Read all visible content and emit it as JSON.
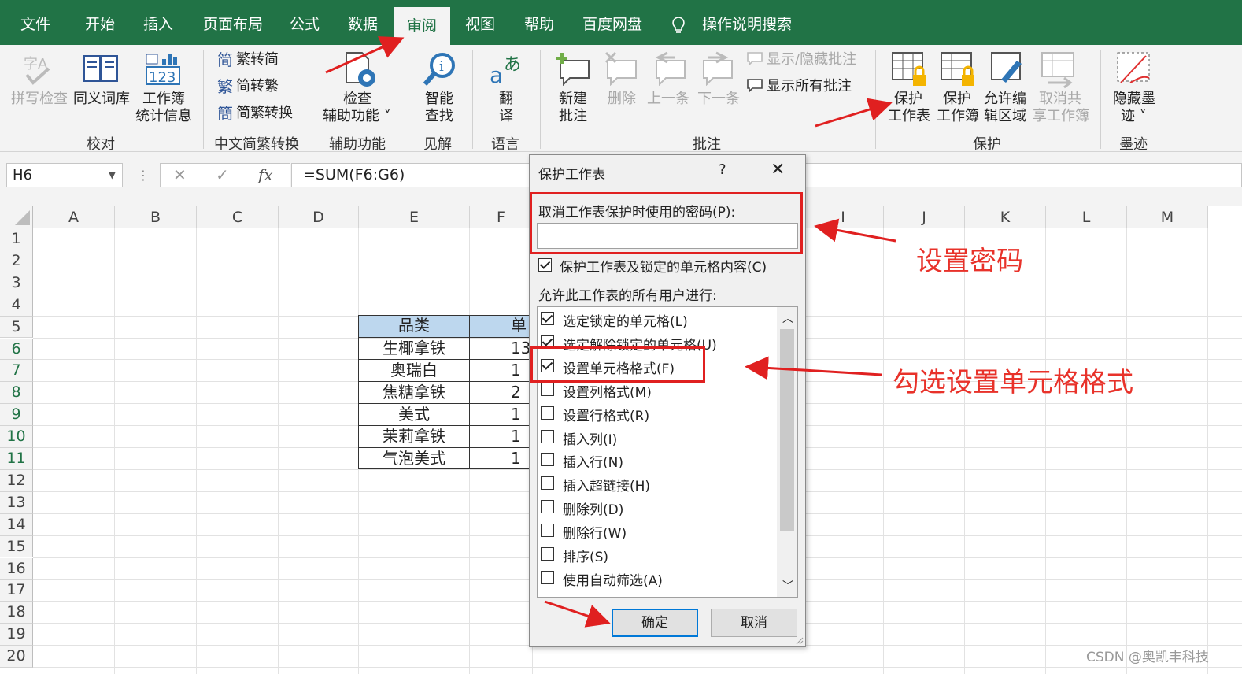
{
  "tabs": [
    "文件",
    "开始",
    "插入",
    "页面布局",
    "公式",
    "数据",
    "审阅",
    "视图",
    "帮助",
    "百度网盘",
    "操作说明搜索"
  ],
  "active_tab": "审阅",
  "ribbon": {
    "proofing": {
      "spell": "拼写检查",
      "thesaurus": "同义词库",
      "stats1": "工作簿",
      "stats2": "统计信息",
      "label": "校对"
    },
    "chinese": {
      "t2s": "繁转简",
      "s2t": "简转繁",
      "convert": "简繁转换",
      "label": "中文简繁转换"
    },
    "accessibility": {
      "check1": "检查",
      "check2": "辅助功能 ˅",
      "label": "辅助功能"
    },
    "insights": {
      "smart1": "智能",
      "smart2": "查找",
      "label": "见解"
    },
    "language": {
      "trans1": "翻",
      "trans2": "译",
      "label": "语言"
    },
    "comments": {
      "new1": "新建",
      "new2": "批注",
      "delete": "删除",
      "prev": "上一条",
      "next": "下一条",
      "showhide": "显示/隐藏批注",
      "showall": "显示所有批注",
      "label": "批注"
    },
    "protect": {
      "sheet1": "保护",
      "sheet2": "工作表",
      "book1": "保护",
      "book2": "工作簿",
      "range1": "允许编",
      "range2": "辑区域",
      "unshare1": "取消共",
      "unshare2": "享工作簿",
      "label": "保护"
    },
    "ink": {
      "hide1": "隐藏墨",
      "hide2": "迹 ˅",
      "label": "墨迹"
    }
  },
  "formula_bar": {
    "name_box": "H6",
    "formula": "=SUM(F6:G6)",
    "fx": "fx"
  },
  "columns": [
    "A",
    "B",
    "C",
    "D",
    "E",
    "F",
    "I",
    "J",
    "K",
    "L",
    "M"
  ],
  "rows": [
    "1",
    "2",
    "3",
    "4",
    "5",
    "6",
    "7",
    "8",
    "9",
    "10",
    "11",
    "12",
    "13",
    "14",
    "15",
    "16",
    "17",
    "18",
    "19",
    "20"
  ],
  "table": {
    "header_e": "品类",
    "header_f": "单",
    "rows": [
      {
        "e": "生椰拿铁",
        "f": "13"
      },
      {
        "e": "奥瑞白",
        "f": "1"
      },
      {
        "e": "焦糖拿铁",
        "f": "2"
      },
      {
        "e": "美式",
        "f": "1"
      },
      {
        "e": "茉莉拿铁",
        "f": "1"
      },
      {
        "e": "气泡美式",
        "f": "1"
      }
    ]
  },
  "dialog": {
    "title": "保护工作表",
    "help": "?",
    "close": "✕",
    "password_label": "取消工作表保护时使用的密码(P):",
    "protect_label": "保护工作表及锁定的单元格内容(C)",
    "allow_label": "允许此工作表的所有用户进行:",
    "options": [
      {
        "label": "选定锁定的单元格(L)",
        "checked": true
      },
      {
        "label": "选定解除锁定的单元格(U)",
        "checked": true
      },
      {
        "label": "设置单元格格式(F)",
        "checked": true
      },
      {
        "label": "设置列格式(M)",
        "checked": false
      },
      {
        "label": "设置行格式(R)",
        "checked": false
      },
      {
        "label": "插入列(I)",
        "checked": false
      },
      {
        "label": "插入行(N)",
        "checked": false
      },
      {
        "label": "插入超链接(H)",
        "checked": false
      },
      {
        "label": "删除列(D)",
        "checked": false
      },
      {
        "label": "删除行(W)",
        "checked": false
      },
      {
        "label": "排序(S)",
        "checked": false
      },
      {
        "label": "使用自动筛选(A)",
        "checked": false
      }
    ],
    "ok": "确定",
    "cancel": "取消"
  },
  "annotations": {
    "password": "设置密码",
    "format": "勾选设置单元格格式"
  },
  "watermark": "CSDN @奥凯丰科技",
  "colors": {
    "excel_green": "#217346",
    "annotation_red": "#e02020",
    "table_header": "#bdd7ee"
  }
}
